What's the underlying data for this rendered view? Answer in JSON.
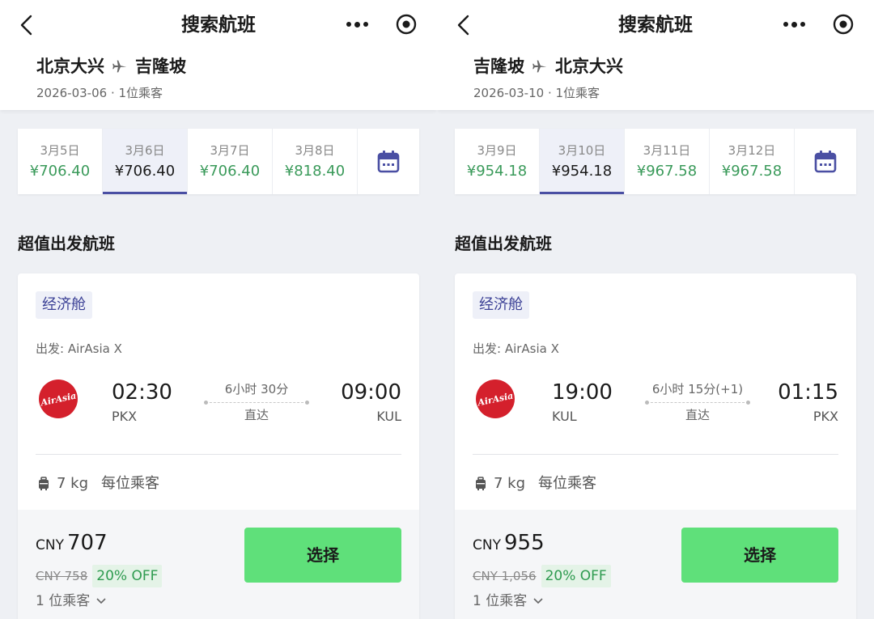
{
  "panels": [
    {
      "nav_title": "搜索航班",
      "route": {
        "from": "北京大兴",
        "to": "吉隆坡"
      },
      "subtitle": "2026-03-06 · 1位乘客",
      "dates": [
        {
          "label": "3月5日",
          "price": "¥706.40",
          "active": false
        },
        {
          "label": "3月6日",
          "price": "¥706.40",
          "active": true
        },
        {
          "label": "3月7日",
          "price": "¥706.40",
          "active": false
        },
        {
          "label": "3月8日",
          "price": "¥818.40",
          "active": false
        }
      ],
      "section_title": "超值出发航班",
      "flight": {
        "cabin": "经济舱",
        "departure_label": "出发: AirAsia X",
        "logo_text": "AirAsia",
        "dep_time": "02:30",
        "dep_code": "PKX",
        "duration": "6小时 30分",
        "stop": "直达",
        "arr_time": "09:00",
        "arr_code": "KUL",
        "baggage": "7 kg",
        "baggage_note": "每位乘客",
        "currency": "CNY",
        "price": "707",
        "original_price": "CNY 758",
        "discount": "20% OFF",
        "passengers": "1 位乘客",
        "select_label": "选择"
      }
    },
    {
      "nav_title": "搜索航班",
      "route": {
        "from": "吉隆坡",
        "to": "北京大兴"
      },
      "subtitle": "2026-03-10 · 1位乘客",
      "dates": [
        {
          "label": "3月9日",
          "price": "¥954.18",
          "active": false
        },
        {
          "label": "3月10日",
          "price": "¥954.18",
          "active": true
        },
        {
          "label": "3月11日",
          "price": "¥967.58",
          "active": false
        },
        {
          "label": "3月12日",
          "price": "¥967.58",
          "active": false
        }
      ],
      "section_title": "超值出发航班",
      "flight": {
        "cabin": "经济舱",
        "departure_label": "出发: AirAsia X",
        "logo_text": "AirAsia",
        "dep_time": "19:00",
        "dep_code": "KUL",
        "duration": "6小时 15分(+1)",
        "stop": "直达",
        "arr_time": "01:15",
        "arr_code": "PKX",
        "baggage": "7 kg",
        "baggage_note": "每位乘客",
        "currency": "CNY",
        "price": "955",
        "original_price": "CNY 1,056",
        "discount": "20% OFF",
        "passengers": "1 位乘客",
        "select_label": "选择"
      }
    }
  ],
  "colors": {
    "accent": "#4a4fa3",
    "price_green": "#3a9a5a",
    "button_green": "#5fe07a",
    "airasia_red": "#d4202c"
  }
}
